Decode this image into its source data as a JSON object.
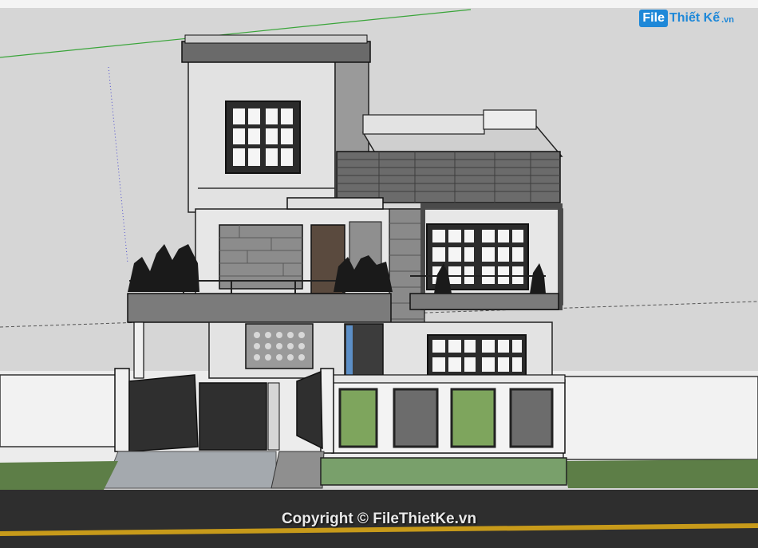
{
  "viewport": {
    "background_color": "#d6d6d6",
    "top_bar_color": "#f4f4f4",
    "ground_color": "#ececec",
    "grass_color": "#5d7e47",
    "road_color": "#2e2e2e",
    "road_line_color": "#c79a1a",
    "axis_green": "#3aa53a",
    "axis_red": "#d04848",
    "axis_blue": "#4f4fd0"
  },
  "scene": {
    "description_icon": "house-3d-model-icon"
  },
  "watermark": {
    "logo_badge": "File",
    "logo_word": "Thiết Kế",
    "logo_tld": ".vn",
    "copyright": "Copyright © FileThietKe.vn"
  }
}
